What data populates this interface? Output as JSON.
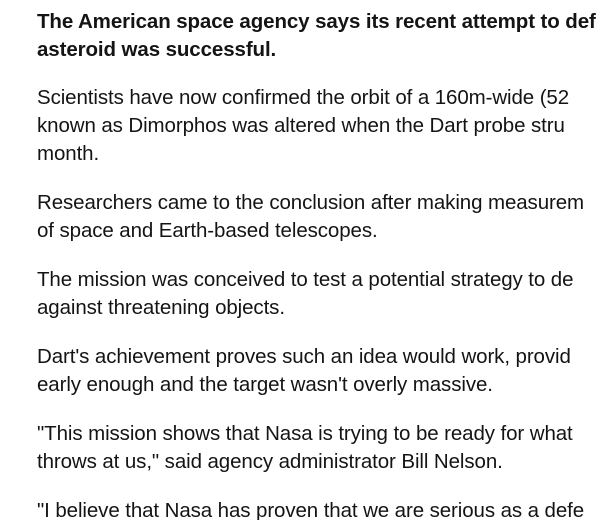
{
  "article": {
    "lede": "The American space agency says its recent attempt to def\nasteroid was successful.",
    "paragraphs": [
      "Scientists have now confirmed the orbit of a 160m-wide (52\nknown as Dimorphos was altered when the Dart probe stru\nmonth.",
      "Researchers came to the conclusion after making measurem\nof space and Earth-based telescopes.",
      "The mission was conceived to test a potential strategy to de\nagainst threatening objects.",
      "Dart's achievement proves such an idea would work, provid\nearly enough and the target wasn't overly massive.",
      "\"This mission shows that Nasa is trying to be ready for what\nthrows at us,\" said agency administrator Bill Nelson.",
      "\"I believe that Nasa has proven that we are serious as a defe"
    ]
  }
}
